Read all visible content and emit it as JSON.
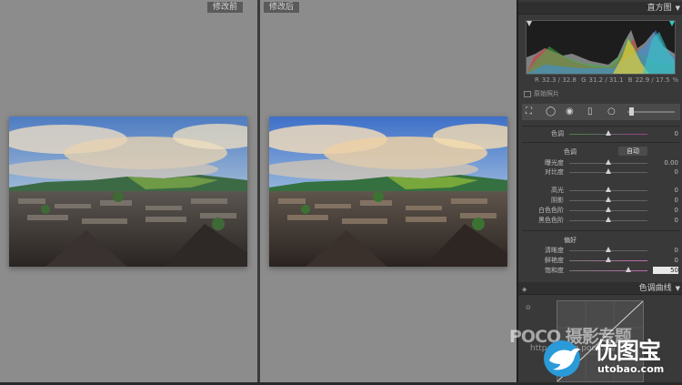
{
  "viewer": {
    "before_label": "修改前",
    "after_label": "修改后"
  },
  "histogram": {
    "title": "直方图",
    "r_label": "R",
    "r_value": "32.3 / 32.8",
    "g_label": "G",
    "g_value": "31.2 / 31.1",
    "b_label": "B",
    "b_value": "22.9 / 17.5",
    "unit": "%",
    "original_photo_label": "原始照片"
  },
  "basic": {
    "tint_label": "色调",
    "tint_value": "0",
    "tone_label": "色调",
    "auto_label": "自动",
    "exposure_label": "曝光度",
    "exposure_value": "0.00",
    "contrast_label": "对比度",
    "contrast_value": "0",
    "highlights_label": "高光",
    "highlights_value": "0",
    "shadows_label": "阴影",
    "shadows_value": "0",
    "whites_label": "白色色阶",
    "whites_value": "0",
    "blacks_label": "黑色色阶",
    "blacks_value": "0",
    "presence_label": "偏好",
    "clarity_label": "清晰度",
    "clarity_value": "0",
    "vibrance_label": "鲜艳度",
    "vibrance_value": "0",
    "saturation_label": "饱和度",
    "saturation_value": "50",
    "slider_levels": {
      "tint": 0.5,
      "exposure": 0.5,
      "contrast": 0.5,
      "highlights": 0.5,
      "shadows": 0.5,
      "whites": 0.5,
      "blacks": 0.5,
      "clarity": 0.5,
      "vibrance": 0.5,
      "saturation": 0.75
    }
  },
  "tone_curve": {
    "title": "色调曲线"
  },
  "watermarks": {
    "poco": "POCO 摄影专题",
    "poco_url": "http://photo.poco.cn/",
    "utobao": "优图宝",
    "utobao_url": "utobao.com"
  },
  "colors": {
    "viewer_bg": "#8c8c8c",
    "panel_bg": "#393939",
    "accent_saturation": "#c46bb0"
  }
}
